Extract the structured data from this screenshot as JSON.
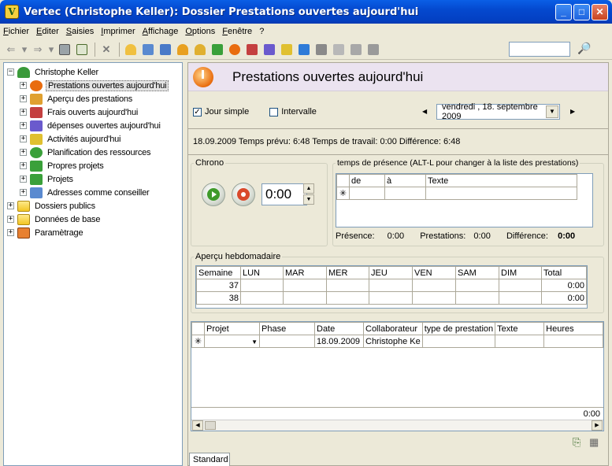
{
  "window": {
    "title": "Vertec (Christophe Keller): Dossier Prestations ouvertes aujourd'hui",
    "app_icon_letter": "V",
    "min_glyph": "_",
    "max_glyph": "□",
    "close_glyph": "✕"
  },
  "menu": [
    "Fichier",
    "Editer",
    "Saisies",
    "Imprimer",
    "Affichage",
    "Options",
    "Fenêtre",
    "?"
  ],
  "toolbar": {
    "back_glyph": "⇐",
    "forward_glyph": "⇒",
    "dropdown_glyph": "▾",
    "delete_glyph": "✕",
    "find_glyph": "🔎",
    "search_value": ""
  },
  "tree": {
    "root": "Christophe Keller",
    "items": [
      "Prestations ouvertes aujourd'hui",
      "Aperçu des prestations",
      "Frais ouverts aujourd'hui",
      "dépenses ouvertes aujourd'hui",
      "Activités aujourd'hui",
      "Planification des ressources",
      "Propres projets",
      "Projets",
      "Adresses comme conseiller"
    ],
    "folders": [
      "Dossiers publics",
      "Données de base",
      "Paramètrage"
    ],
    "expand_plus": "+",
    "expand_minus": "−"
  },
  "header": {
    "title": "Prestations ouvertes aujourd'hui"
  },
  "options": {
    "jour_simple": "Jour simple",
    "jour_simple_checked": "✓",
    "intervalle": "Intervalle",
    "prev_glyph": "◀",
    "next_glyph": "▶",
    "date_value": "vendredi  , 18. septembre 2009",
    "date_dd_glyph": "▼"
  },
  "info": {
    "line": "18.09.2009  Temps prévu: 6:48  Temps de travail: 0:00  Différence:  6:48"
  },
  "chrono": {
    "legend": "Chrono",
    "value": "0:00",
    "spin_up": "▲",
    "spin_down": "▼"
  },
  "presence": {
    "legend": "temps de présence (ALT-L pour changer à la liste des prestations)",
    "columns": [
      "de",
      "à",
      "Texte"
    ],
    "new_row_marker": "✳",
    "presence_label": "Présence:",
    "presence_value": "0:00",
    "prestations_label": "Prestations:",
    "prestations_value": "0:00",
    "difference_label": "Différence:",
    "difference_value": "0:00"
  },
  "weekly": {
    "legend": "Aperçu hebdomadaire",
    "columns": [
      "Semaine",
      "LUN",
      "MAR",
      "MER",
      "JEU",
      "VEN",
      "SAM",
      "DIM",
      "Total"
    ],
    "rows": [
      {
        "week": "37",
        "total": "0:00"
      },
      {
        "week": "38",
        "total": "0:00"
      }
    ]
  },
  "services": {
    "columns": [
      "Projet",
      "Phase",
      "Date",
      "Collaborateur",
      "type de prestation",
      "Texte",
      "Heures"
    ],
    "new_row_marker": "✳",
    "dropdown_glyph": "▼",
    "row_date": "18.09.2009",
    "row_collab": "Christophe Ke",
    "sum_hours": "0:00",
    "scroll_left": "◀",
    "scroll_right": "▶"
  },
  "footer": {
    "tab_label": "Standard",
    "icon_new": "⎘",
    "icon_grid": "▦"
  },
  "colors": {
    "titlebar": "#0449cf",
    "header_bg": "#ebe3f0",
    "selection": "#e4e4e4"
  }
}
